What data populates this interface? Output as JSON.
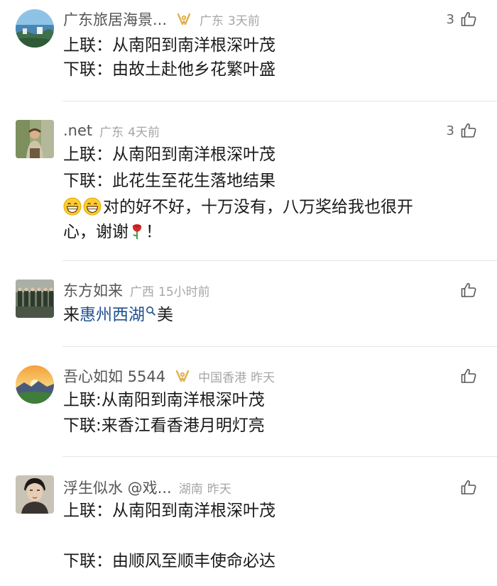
{
  "comments": [
    {
      "name": "广东旅居海景...",
      "location": "广东",
      "time": "3天前",
      "likes": "3",
      "lines": [
        "上联：从南阳到南洋根深叶茂",
        "下联：由故土赴他乡花繁叶盛"
      ]
    },
    {
      "name": ".net",
      "location": "广东",
      "time": "4天前",
      "likes": "3",
      "lines": [
        "上联：从南阳到南洋根深叶茂",
        "下联：此花生至花生落地结果"
      ],
      "emoji_text": "对的好不好，十万没有，八万奖给我也很开",
      "emoji_tail_pre": "心，谢谢",
      "emoji_tail_post": "！"
    },
    {
      "name": "东方如来",
      "location": "广西",
      "time": "15小时前",
      "likes": "",
      "prefix": "来",
      "link": "惠州西湖",
      "suffix": "美"
    },
    {
      "name": "吾心如如 5544",
      "location": "中国香港",
      "time": "昨天",
      "likes": "",
      "lines": [
        "上联:从南阳到南洋根深叶茂",
        "下联:来香江看香港月明灯亮"
      ]
    },
    {
      "name": "浮生似水 @戏...",
      "location": "湖南",
      "time": "昨天",
      "likes": "",
      "lines": [
        "上联：从南阳到南洋根深叶茂",
        "下联：由顺风至顺丰使命必达"
      ]
    }
  ],
  "icons": {
    "badge": "gold-link-badge-icon",
    "like": "thumbs-up-icon",
    "emoji": "grinning-face-emoji",
    "rose": "rose-emoji",
    "search": "search-icon"
  },
  "colors": {
    "name": "#555555",
    "meta": "#a6a6a6",
    "text": "#1a1a1a",
    "link": "#1f4f8f",
    "badge": "#e0b04a",
    "divider": "#e6e6e6"
  }
}
